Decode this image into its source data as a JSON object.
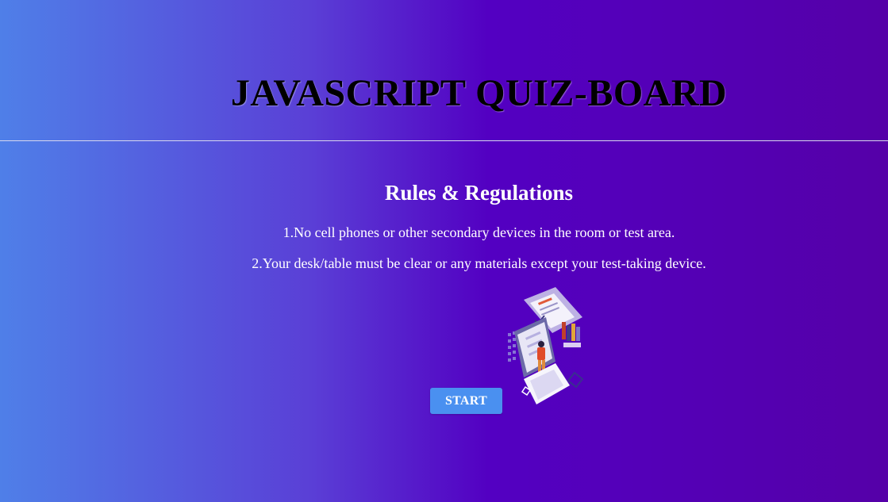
{
  "header": {
    "title": "JAVASCRIPT QUIZ-BOARD"
  },
  "rules": {
    "heading": "Rules & Regulations",
    "items": [
      "1.No cell phones or other secondary devices in the room or test area.",
      "2.Your desk/table must be clear or any materials except your test-taking device."
    ]
  },
  "illustration": {
    "icon": "quiz-illustration-icon"
  },
  "actions": {
    "start_label": "START"
  },
  "colors": {
    "gradient_start": "#4f7fe8",
    "gradient_mid": "#5300c2",
    "gradient_end": "#5500a8",
    "button": "#4a90f0",
    "title_text": "#000000"
  }
}
